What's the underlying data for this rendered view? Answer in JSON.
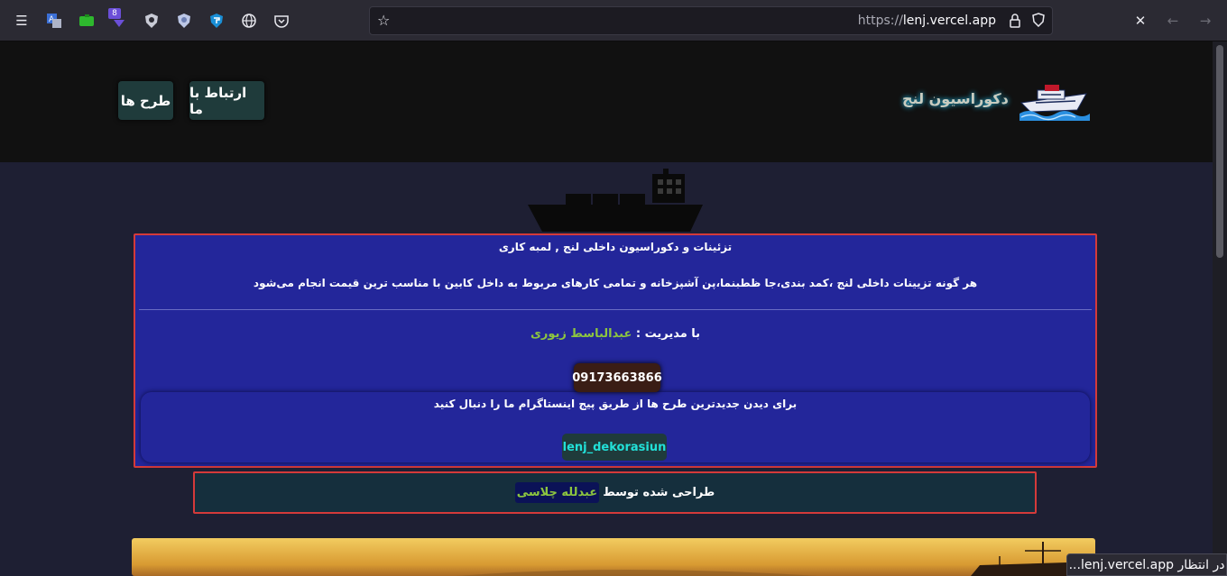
{
  "browser": {
    "url_scheme": "https://",
    "url_host": "lenj.vercel.app",
    "extension_badge": "8"
  },
  "header": {
    "brand": "دکوراسیون لنج",
    "nav": [
      "ارتباط با ما",
      "طرح ها"
    ]
  },
  "main": {
    "title": "تزئینات و دکوراسیون داخلی لنج , لمبه کاری",
    "description": "هر گونه تزیینات داخلی لنج ،کمد بندی،جا ظطبنما،پن آشپزخانه و تمامی کارهای مربوط به داخل کابین با مناسب ترین قیمت انجام می‌شود",
    "manager_label": "با مدیریت :",
    "manager_name": "عبدالباسط زیوری",
    "phone": "09173663866",
    "instagram_text": "برای دیدن جدیدترین طرح ها از طریق پیج اینستاگرام ما را دنبال کنید",
    "instagram_handle": "lenj_dekorasiun"
  },
  "footer": {
    "designed_by": "طراحی شده توسط",
    "designer": "عبدلله چلاسی"
  },
  "status_bar": "در انتظار lenj.vercel.app..."
}
